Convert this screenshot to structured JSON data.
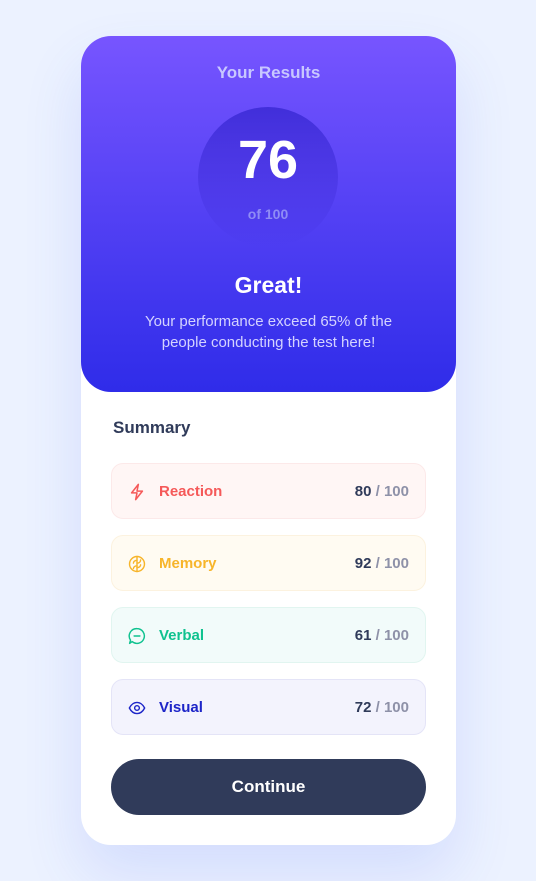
{
  "results": {
    "title": "Your Results",
    "score": "76",
    "score_of": "of 100",
    "rating": "Great!",
    "message": "Your performance exceed 65% of the people conducting the test here!"
  },
  "summary": {
    "heading": "Summary",
    "items": [
      {
        "label": "Reaction",
        "score": "80",
        "total": "/ 100",
        "icon": "lightning-icon",
        "color": "#f55959",
        "bg": "#fff6f5"
      },
      {
        "label": "Memory",
        "score": "92",
        "total": "/ 100",
        "icon": "brain-icon",
        "color": "#f7b52b",
        "bg": "#fffbf2"
      },
      {
        "label": "Verbal",
        "score": "61",
        "total": "/ 100",
        "icon": "chat-bubble-icon",
        "color": "#0fc28f",
        "bg": "#f2fbfa"
      },
      {
        "label": "Visual",
        "score": "72",
        "total": "/ 100",
        "icon": "eye-icon",
        "color": "#1d25c8",
        "bg": "#f3f3fd"
      }
    ]
  },
  "continue_label": "Continue"
}
